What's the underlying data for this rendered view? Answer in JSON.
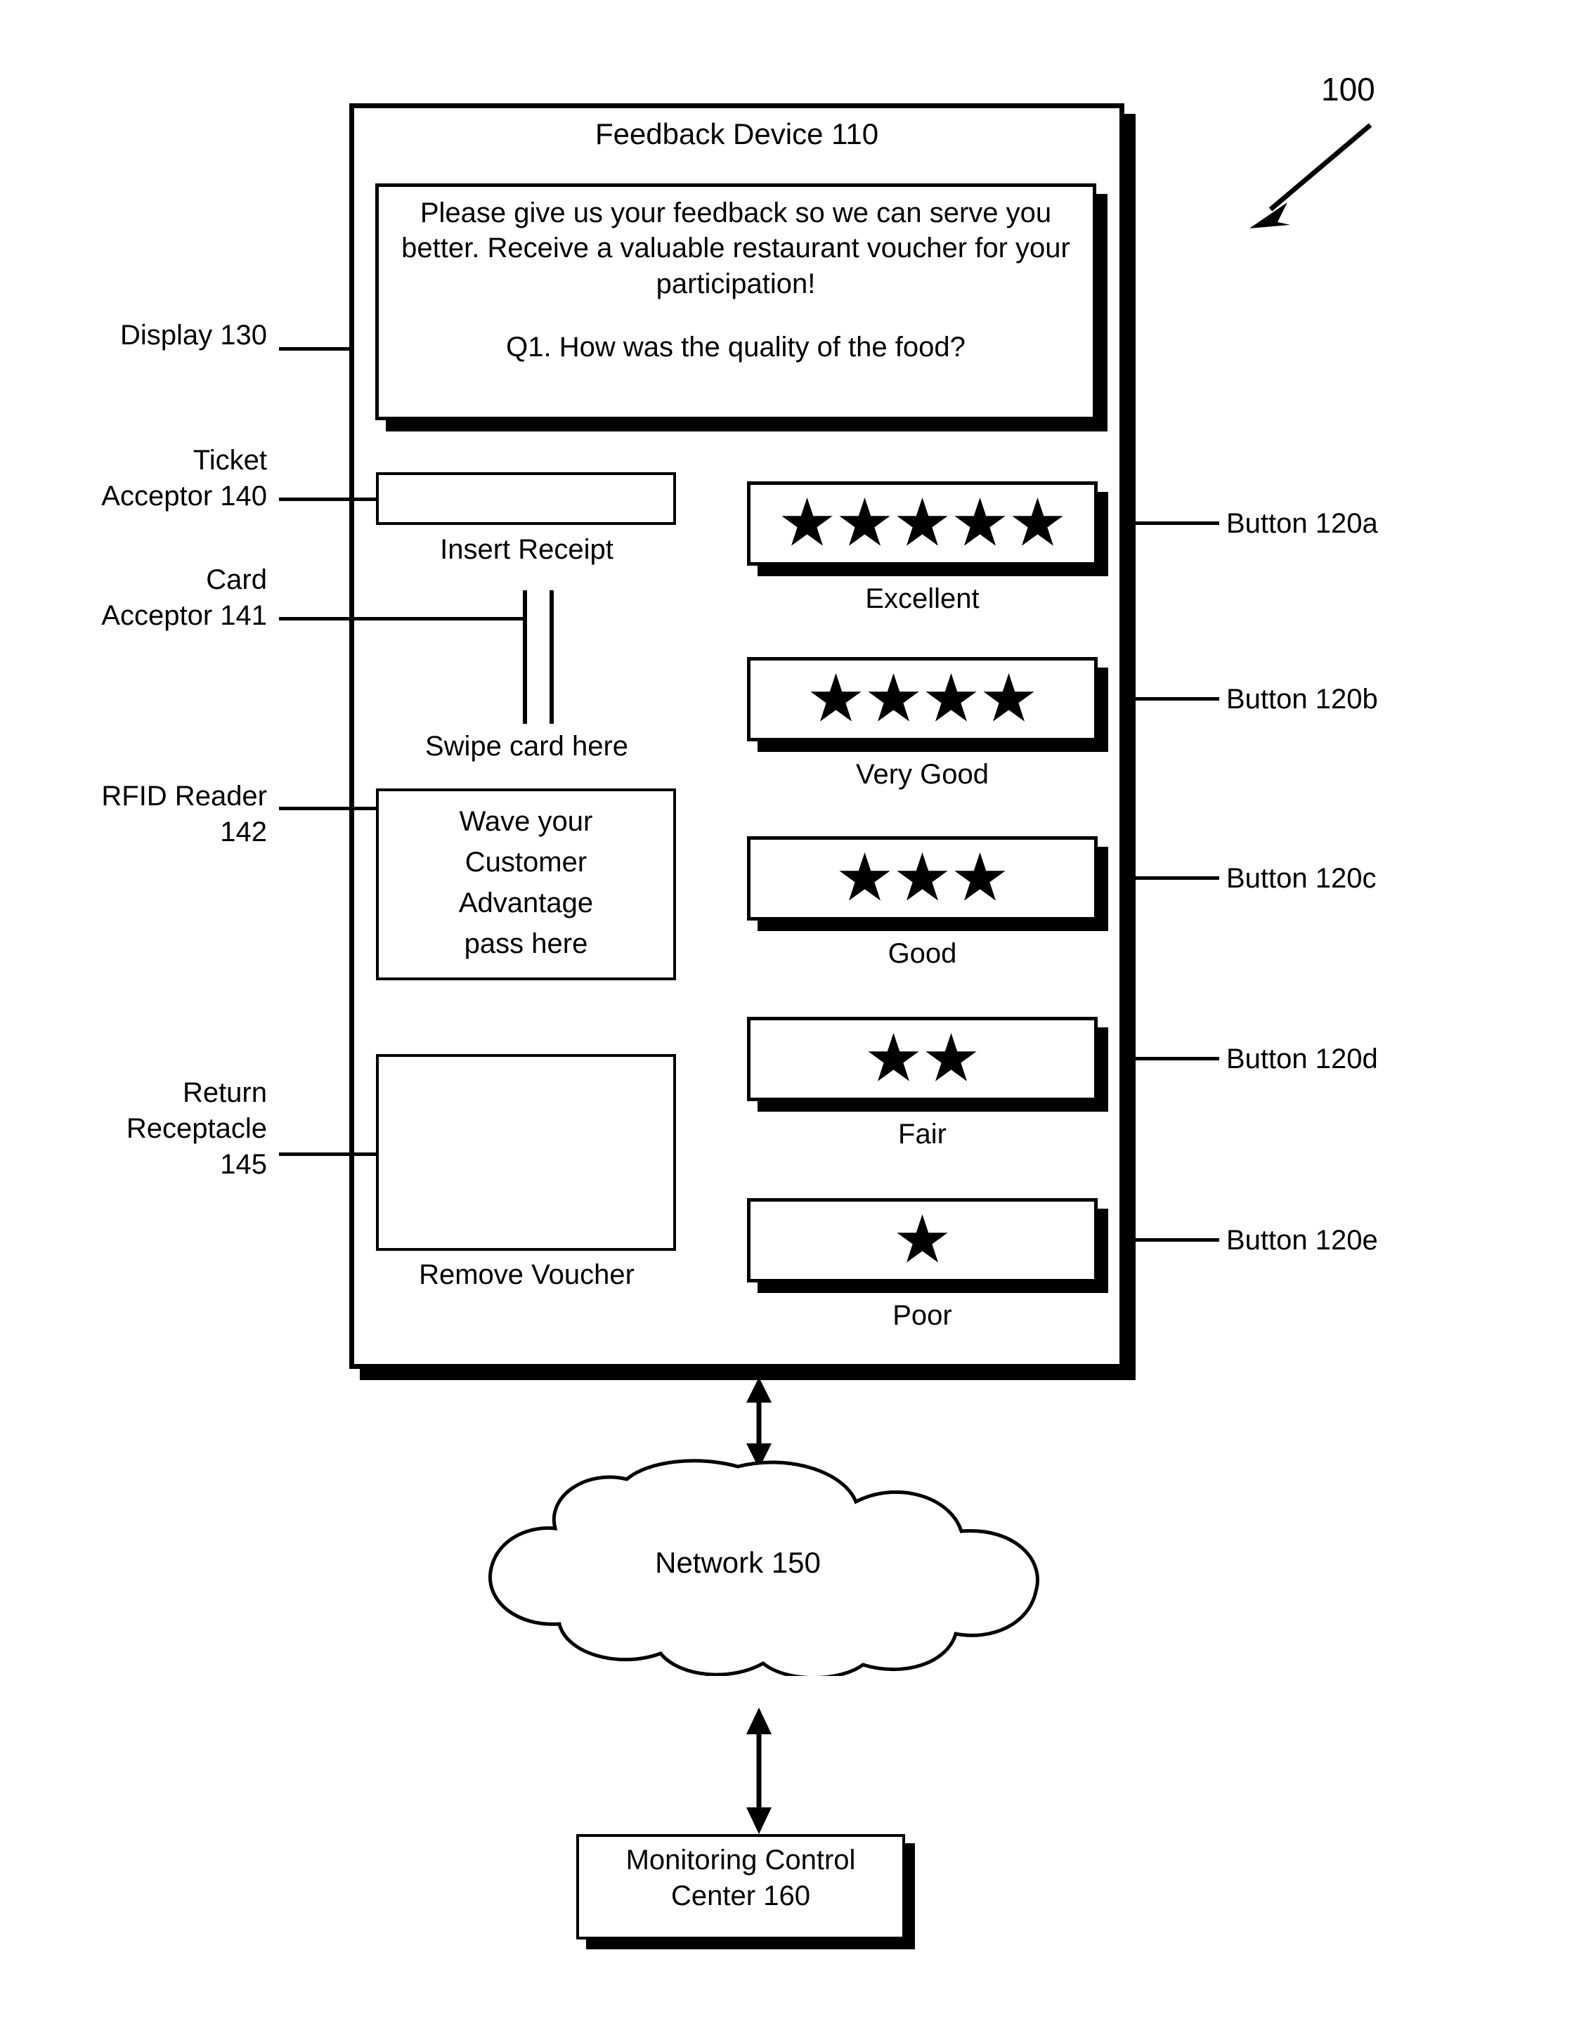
{
  "figure": {
    "reference_number": "100",
    "arrow": "diagonal-arrow-pointing-down-left"
  },
  "device": {
    "title": "Feedback Device 110",
    "display": {
      "label": "Display 130",
      "paragraph": "Please give us your feedback so we can serve you better. Receive a valuable restaurant voucher for your participation!",
      "question": "Q1. How was the quality of the food?"
    },
    "ticket_acceptor": {
      "label": "Ticket\nAcceptor 140",
      "label_line1": "Ticket",
      "label_line2": "Acceptor 140",
      "caption": "Insert Receipt"
    },
    "card_acceptor": {
      "label_line1": "Card",
      "label_line2": "Acceptor 141",
      "caption": "Swipe card here"
    },
    "rfid_reader": {
      "label_line1": "RFID Reader",
      "label_line2": "142",
      "text_line1": "Wave your",
      "text_line2": "Customer",
      "text_line3": "Advantage",
      "text_line4": "pass here"
    },
    "return_receptacle": {
      "label_line1": "Return",
      "label_line2": "Receptacle",
      "label_line3": "145",
      "caption": "Remove Voucher"
    },
    "buttons": [
      {
        "id": "120a",
        "stars": 5,
        "caption": "Excellent",
        "callout": "Button 120a"
      },
      {
        "id": "120b",
        "stars": 4,
        "caption": "Very Good",
        "callout": "Button 120b"
      },
      {
        "id": "120c",
        "stars": 3,
        "caption": "Good",
        "callout": "Button 120c"
      },
      {
        "id": "120d",
        "stars": 2,
        "caption": "Fair",
        "callout": "Button 120d"
      },
      {
        "id": "120e",
        "stars": 1,
        "caption": "Poor",
        "callout": "Button 120e"
      }
    ]
  },
  "network": {
    "label": "Network 150"
  },
  "monitoring_control_center": {
    "line1": "Monitoring Control",
    "line2": "Center 160"
  },
  "colors": {
    "stroke": "#000000",
    "background": "#ffffff"
  }
}
